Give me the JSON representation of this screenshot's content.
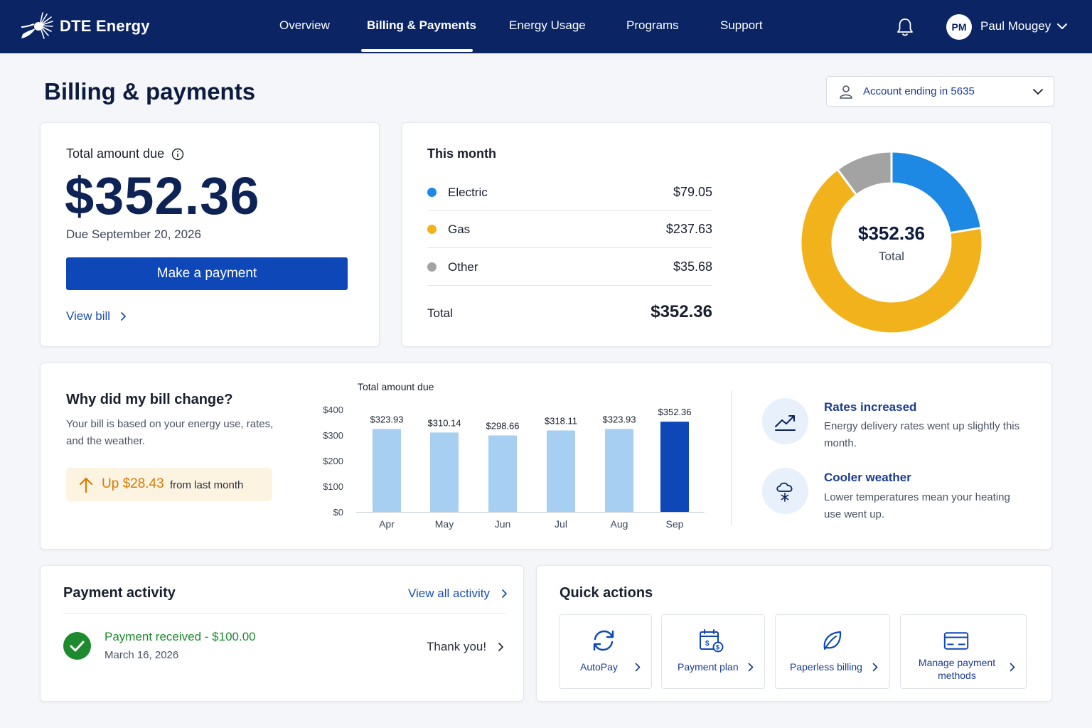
{
  "brand": {
    "name": "DTE Energy"
  },
  "nav": {
    "items": [
      {
        "label": "Overview"
      },
      {
        "label": "Billing & Payments",
        "active": true
      },
      {
        "label": "Energy Usage"
      },
      {
        "label": "Programs"
      },
      {
        "label": "Support"
      }
    ],
    "user": {
      "initials": "PM",
      "name": "Paul Mougey"
    }
  },
  "page": {
    "title": "Billing & payments",
    "account_selector": "Account ending in 5635"
  },
  "amount_due": {
    "label": "Total amount due",
    "amount": "$352.36",
    "due_date": "Due September 20, 2026",
    "pay_button": "Make a payment",
    "view_bill": "View bill"
  },
  "this_month": {
    "title": "This month",
    "items": [
      {
        "name": "Electric",
        "value": "$79.05",
        "color": "#1e88e5"
      },
      {
        "name": "Gas",
        "value": "$237.63",
        "color": "#f2b21b"
      },
      {
        "name": "Other",
        "value": "$35.68",
        "color": "#a3a3a3"
      }
    ],
    "total_label": "Total",
    "total_value": "$352.36",
    "donut_center_amount": "$352.36",
    "donut_center_label": "Total"
  },
  "bill_change": {
    "title": "Why did my bill change?",
    "description": "Your bill is based on your energy use, rates, and the weather.",
    "change_amount": "Up $28.43",
    "change_suffix": "from last month",
    "reasons": [
      {
        "title": "Rates increased",
        "description": "Energy delivery rates went up slightly this month.",
        "icon": "trend-up-icon"
      },
      {
        "title": "Cooler weather",
        "description": "Lower temperatures mean your heating use went up.",
        "icon": "snow-cloud-icon"
      }
    ]
  },
  "chart_data": {
    "type": "bar",
    "title": "Total amount due",
    "categories": [
      "Apr",
      "May",
      "Jun",
      "Jul",
      "Aug",
      "Sep"
    ],
    "values": [
      323.93,
      310.14,
      298.66,
      318.11,
      323.93,
      352.36
    ],
    "value_labels": [
      "$323.93",
      "$310.14",
      "$298.66",
      "$318.11",
      "$323.93",
      "$352.36"
    ],
    "y_ticks": [
      "$0",
      "$100",
      "$200",
      "$300",
      "$400"
    ],
    "ylim": [
      0,
      400
    ],
    "highlight_index": 5,
    "colors": {
      "default": "#a6cff2",
      "highlight": "#0d47b8"
    }
  },
  "payment_activity": {
    "title": "Payment activity",
    "view_all": "View all activity",
    "item": {
      "title": "Payment received - $100.00",
      "date": "March 16, 2026",
      "note": "Thank you!"
    }
  },
  "quick_actions": {
    "title": "Quick actions",
    "items": [
      {
        "label": "AutoPay",
        "icon": "autopay-icon"
      },
      {
        "label": "Payment plan",
        "icon": "payment-plan-icon"
      },
      {
        "label": "Paperless billing",
        "icon": "leaf-icon"
      },
      {
        "label": "Manage payment methods",
        "icon": "card-icon"
      }
    ]
  },
  "colors": {
    "nav_bg": "#0b2463",
    "primary": "#0d47b8",
    "link": "#1a4fb5",
    "success": "#1e8a2e",
    "warning": "#d97a06"
  }
}
